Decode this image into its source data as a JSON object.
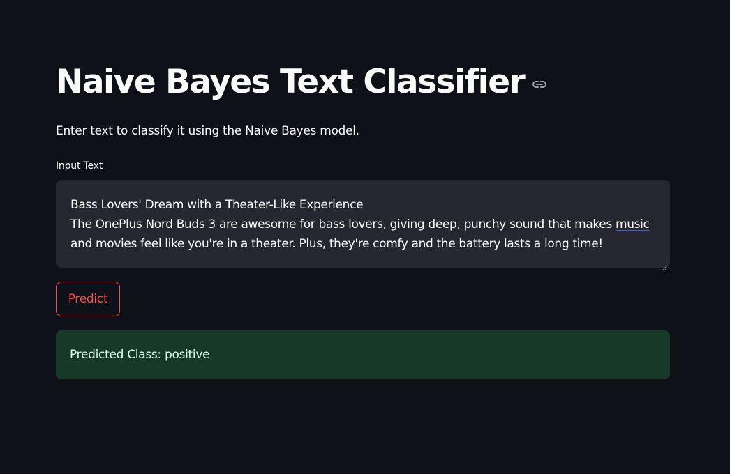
{
  "header": {
    "title": "Naive Bayes Text Classifier",
    "anchor_icon": "link-icon"
  },
  "description": "Enter text to classify it using the Naive Bayes model.",
  "input": {
    "label": "Input Text",
    "value_line1": "Bass Lovers' Dream with a Theater-Like Experience",
    "value_line2_before": "The OnePlus Nord Buds 3 are awesome for bass lovers, giving deep, punchy sound that makes ",
    "value_line2_spell": "music",
    "value_line3": "and movies feel like you're in a theater. Plus, they're comfy and the battery lasts a long time!"
  },
  "predict_button": {
    "label": "Predict"
  },
  "result": {
    "text": "Predicted Class: positive"
  },
  "colors": {
    "background": "#0e1117",
    "input_bg": "#262730",
    "accent": "#ff4b4b",
    "success_bg": "#173928",
    "success_text": "#dffde9"
  }
}
